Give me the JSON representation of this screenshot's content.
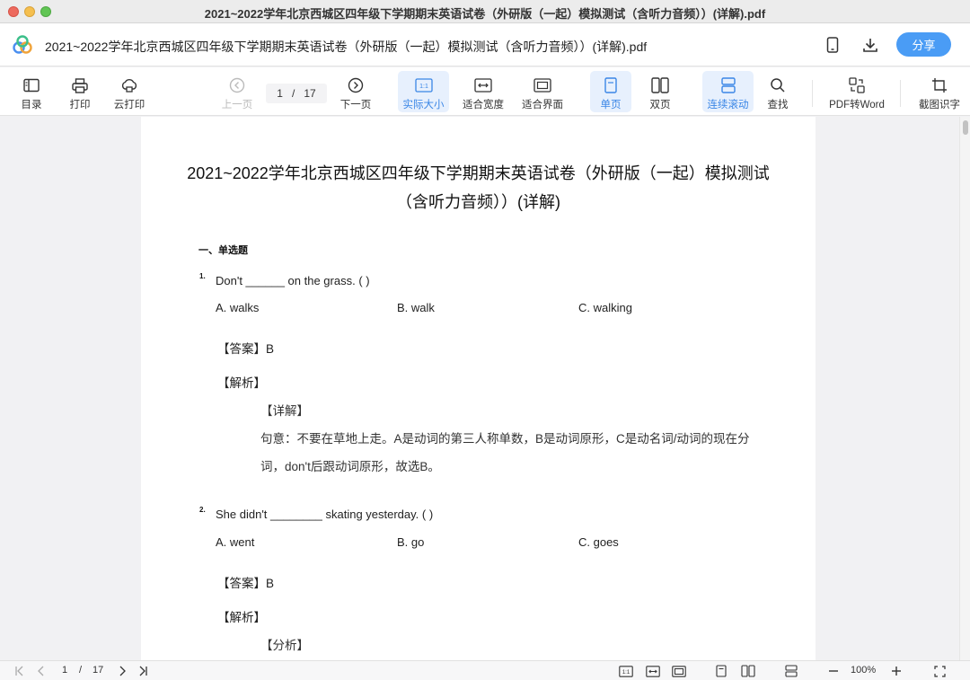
{
  "window": {
    "title": "2021~2022学年北京西城区四年级下学期期末英语试卷（外研版（一起）模拟测试（含听力音频））(详解).pdf"
  },
  "header": {
    "doc_title": "2021~2022学年北京西城区四年级下学期期末英语试卷（外研版（一起）模拟测试（含听力音频））(详解).pdf",
    "share_label": "分享",
    "icons": [
      "phone-icon",
      "download-icon"
    ]
  },
  "toolbar": {
    "toc": "目录",
    "print": "打印",
    "cloud_print": "云打印",
    "prev_page": "上一页",
    "current_page": "1",
    "page_sep": "/",
    "total_pages": "17",
    "next_page": "下一页",
    "actual_size": "实际大小",
    "actual_size_glyph": "1:1",
    "fit_width": "适合宽度",
    "fit_page": "适合界面",
    "single_page": "单页",
    "double_page": "双页",
    "continuous": "连续滚动",
    "find": "查找",
    "pdf_to_word": "PDF转Word",
    "ocr": "截图识字",
    "active_color": "#3a86e6"
  },
  "document": {
    "title_line1": "2021~2022学年北京西城区四年级下学期期末英语试卷（外研版（一起）模拟测试",
    "title_line2": "（含听力音频））(详解)",
    "section": "一、单选题",
    "questions": [
      {
        "num": "1.",
        "text": "Don't ______ on the grass. (      )",
        "options": [
          "A. walks",
          "B. walk",
          "C. walking"
        ],
        "answer": "【答案】B",
        "analysis_label": "【解析】",
        "detail_label": "【详解】",
        "detail_line1": "句意：不要在草地上走。A是动词的第三人称单数，B是动词原形，C是动名词/动词的现在分",
        "detail_line2": "词，don't后跟动词原形，故选B。"
      },
      {
        "num": "2.",
        "text": "She didn't ________ skating yesterday. (      )",
        "options": [
          "A. went",
          "B. go",
          "C. goes"
        ],
        "answer": "【答案】B",
        "analysis_label": "【解析】",
        "detail_label": "【分析】"
      }
    ]
  },
  "statusbar": {
    "current_page": "1",
    "page_sep": "/",
    "total_pages": "17",
    "zoom": "100%",
    "actual_size_glyph": "1:1"
  }
}
